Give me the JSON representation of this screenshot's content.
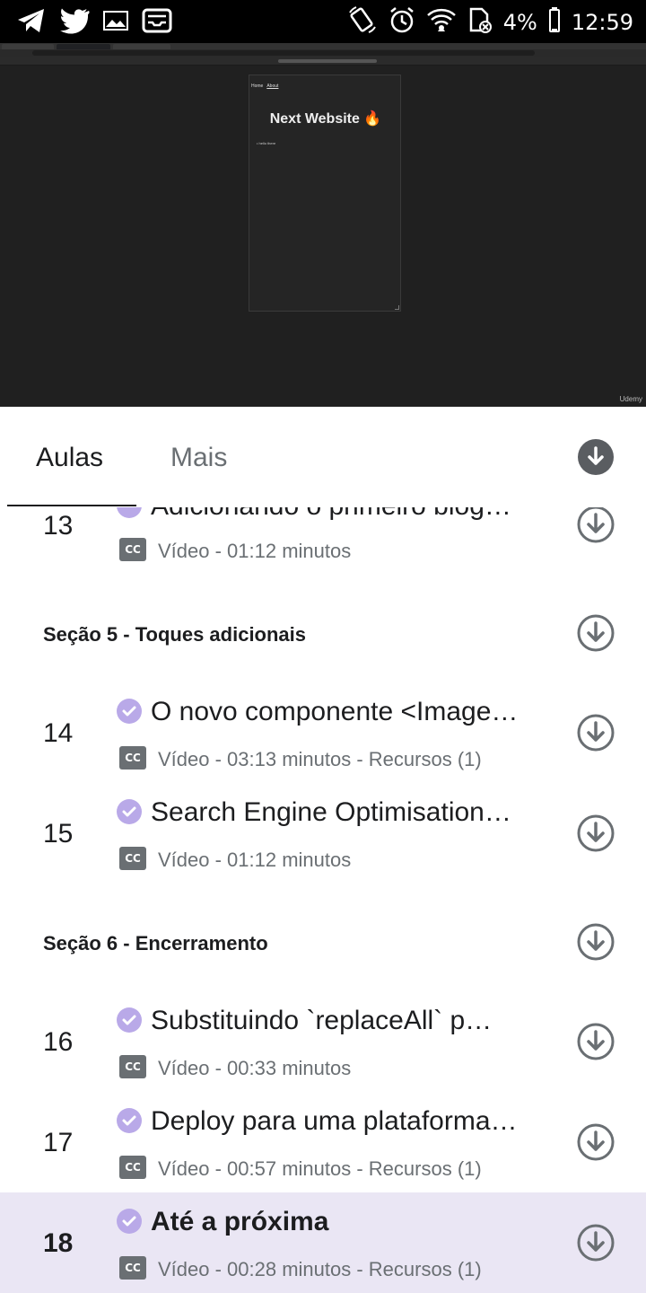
{
  "status_bar": {
    "battery": "4%",
    "time": "12:59",
    "icons": [
      "telegram-icon",
      "twitter-icon",
      "gallery-icon",
      "mail-icon",
      "rotate-icon",
      "alarm-icon",
      "wifi-icon",
      "sd-card-icon",
      "battery-icon"
    ]
  },
  "video": {
    "page_nav_home": "Home",
    "page_nav_about": "About",
    "page_title": "Next Website 🔥",
    "page_list_item": "• hello there",
    "watermark": "Udemy"
  },
  "tabs": {
    "lessons": "Aulas",
    "more": "Mais"
  },
  "lessons": {
    "l13": {
      "number": "13",
      "title": "Adicionando o primeiro blog…",
      "meta": "Vídeo - 01:12 minutos"
    },
    "section5": "Seção 5 - Toques adicionais",
    "l14": {
      "number": "14",
      "title": "O novo componente <Image…",
      "meta": "Vídeo - 03:13 minutos - Recursos (1)"
    },
    "l15": {
      "number": "15",
      "title": "Search Engine Optimisation…",
      "meta": "Vídeo - 01:12 minutos"
    },
    "section6": "Seção 6 - Encerramento",
    "l16": {
      "number": "16",
      "title": "Substituindo `replaceAll` p…",
      "meta": "Vídeo - 00:33 minutos"
    },
    "l17": {
      "number": "17",
      "title": "Deploy para uma plataforma…",
      "meta": "Vídeo - 00:57 minutos - Recursos (1)"
    },
    "l18": {
      "number": "18",
      "title": "Até a próxima",
      "meta": "Vídeo - 00:28 minutos - Recursos (1)"
    }
  },
  "cc_label": "CC",
  "colors": {
    "accent_check": "#b9a9e8",
    "highlight_row": "#eae6f4",
    "icon_gray": "#6a6f73"
  }
}
